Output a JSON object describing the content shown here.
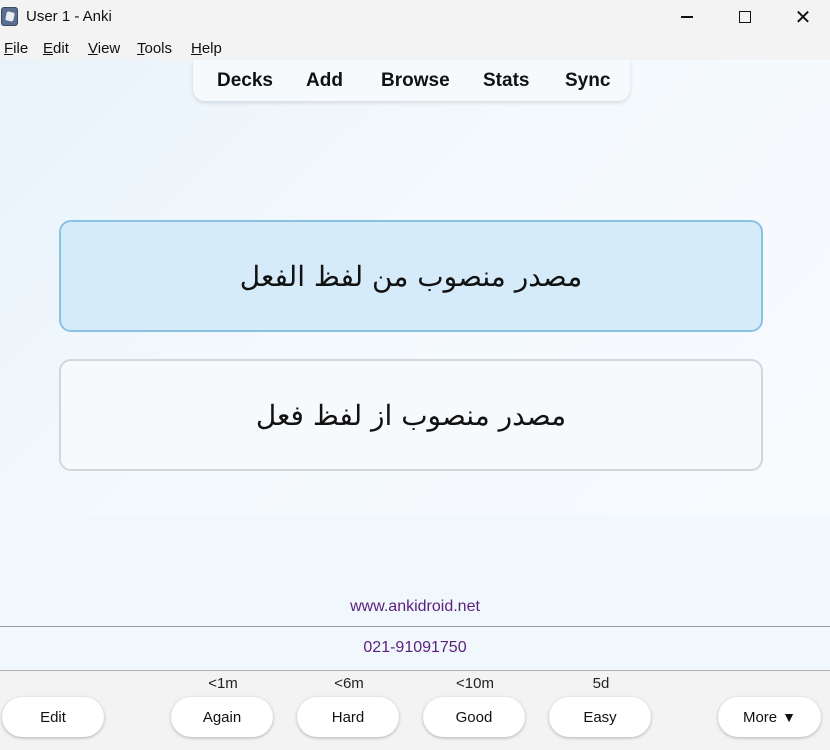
{
  "window": {
    "title": "User 1 - Anki",
    "icon": "anki-app-icon"
  },
  "menu": [
    {
      "label": "File",
      "accel": "F",
      "rest": "ile"
    },
    {
      "label": "Edit",
      "accel": "E",
      "rest": "dit"
    },
    {
      "label": "View",
      "accel": "V",
      "rest": "iew"
    },
    {
      "label": "Tools",
      "accel": "T",
      "rest": "ools"
    },
    {
      "label": "Help",
      "accel": "H",
      "rest": "elp"
    }
  ],
  "toolbar": {
    "decks": "Decks",
    "add": "Add",
    "browse": "Browse",
    "stats": "Stats",
    "sync": "Sync"
  },
  "cards": {
    "front": "مصدر منصوب من لفظ الفعل",
    "back": "مصدر منصوب از لفظ فعل"
  },
  "footer": {
    "website": "www.ankidroid.net",
    "phone": "021-91091750"
  },
  "answer": {
    "edit": "Edit",
    "again": {
      "label": "Again",
      "interval": "<1m"
    },
    "hard": {
      "label": "Hard",
      "interval": "<6m"
    },
    "good": {
      "label": "Good",
      "interval": "<10m"
    },
    "easy": {
      "label": "Easy",
      "interval": "5d"
    },
    "more": "More",
    "more_arrow": "▼"
  },
  "colors": {
    "link": "#5b1f7c",
    "card_front_bg": "#d5ebfa",
    "card_front_border": "#88c3e6"
  }
}
